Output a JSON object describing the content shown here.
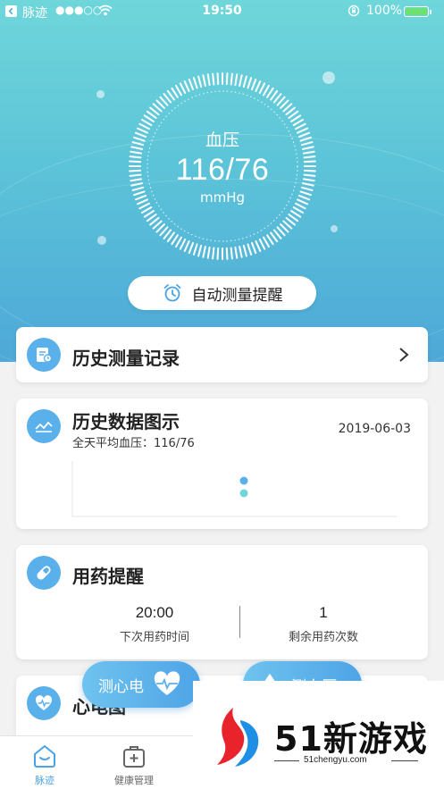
{
  "status_bar": {
    "carrier": "脉迹",
    "signal": "●●●○○",
    "time": "19:50",
    "battery_text": "100%"
  },
  "gauge": {
    "label": "血压",
    "value": "116/76",
    "unit": "mmHg"
  },
  "auto_remind": {
    "label": "自动测量提醒"
  },
  "history_records": {
    "title": "历史测量记录"
  },
  "history_chart": {
    "title": "历史数据图示",
    "subtitle": "全天平均血压：116/76",
    "date": "2019-06-03"
  },
  "medication": {
    "title": "用药提醒",
    "next_time_value": "20:00",
    "next_time_caption": "下次用药时间",
    "remaining_value": "1",
    "remaining_caption": "剩余用药次数"
  },
  "ecg_card": {
    "title": "心电图"
  },
  "float_buttons": {
    "ecg": "测心电",
    "bp": "测血压"
  },
  "tabbar": {
    "tabs": [
      {
        "label": "脉迹"
      },
      {
        "label": "健康管理"
      }
    ]
  },
  "watermark": {
    "brand": "51新游戏",
    "url": "51chengyu.com"
  },
  "colors": {
    "accent": "#5ab0ea",
    "hero_top": "#6fd6da",
    "hero_bottom": "#4ea8d8",
    "tab_active": "#4aa3e6",
    "tab_inactive": "#666666"
  }
}
